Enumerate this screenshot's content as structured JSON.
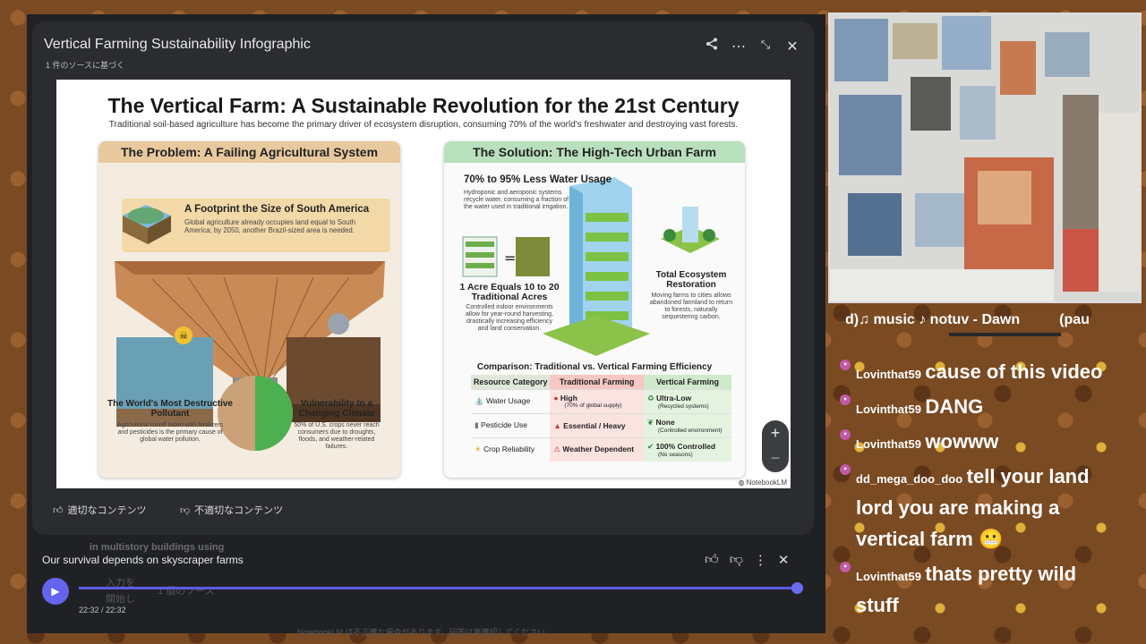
{
  "modal": {
    "title": "Vertical Farming Sustainability Infographic",
    "subtitle": "1 件のソースに基づく",
    "tool_icons": [
      "share-icon",
      "more-icon",
      "collapse-icon",
      "close-icon"
    ]
  },
  "infographic": {
    "title": "The Vertical Farm: A Sustainable Revolution for the 21st Century",
    "subtitle": "Traditional soil-based agriculture has become the primary driver of ecosystem disruption, consuming 70% of the world's freshwater and destroying vast forests.",
    "problem": {
      "heading": "The Problem: A Failing Agricultural System",
      "footprint_title": "A Footprint the Size of South America",
      "footprint_text": "Global agriculture already occupies land equal to South America; by 2050, another Brazil-sized area is needed.",
      "pollutant_title": "The World's Most Destructive Pollutant",
      "pollutant_text": "Agricultural runoff laden with fertilizers and pesticides is the primary cause of global water pollution.",
      "climate_title": "Vulnerability to a Changing Climate",
      "climate_text": "50% of U.S. crops never reach consumers due to droughts, floods, and weather-related failures."
    },
    "solution": {
      "heading": "The Solution: The High-Tech Urban Farm",
      "water_title": "70% to 95% Less Water Usage",
      "water_text": "Hydroponic and aeroponic systems recycle water, consuming a fraction of the water used in traditional irrigation.",
      "acre_title": "1 Acre Equals 10 to 20 Traditional Acres",
      "acre_text": "Controlled indoor environments allow for year-round harvesting, drastically increasing efficiency and land conservation.",
      "eco_title": "Total Ecosystem Restoration",
      "eco_text": "Moving farms to cities allows abandoned farmland to return to forests, naturally sequestering carbon.",
      "compare_title": "Comparison: Traditional vs. Vertical Farming Efficiency",
      "table_headers": [
        "Resource Category",
        "Traditional Farming",
        "Vertical Farming"
      ],
      "table_rows": [
        {
          "category": "Water Usage",
          "trad": "High",
          "trad_note": "(70% of global supply)",
          "vert": "Ultra-Low",
          "vert_note": "(Recycled systems)"
        },
        {
          "category": "Pesticide Use",
          "trad": "Essential / Heavy",
          "trad_note": "",
          "vert": "None",
          "vert_note": "(Controlled environment)"
        },
        {
          "category": "Crop Reliability",
          "trad": "Weather Dependent",
          "trad_note": "",
          "vert": "100% Controlled",
          "vert_note": "(No seasons)"
        }
      ]
    },
    "watermark": "NotebookLM"
  },
  "zoom": {
    "plus": "+",
    "minus": "−"
  },
  "feedback": {
    "good": "適切なコンテンツ",
    "bad": "不適切なコンテンツ"
  },
  "player": {
    "title": "Our survival depends on skyscraper farms",
    "time": "22:32 / 22:32",
    "progress": 1.0
  },
  "background_ghost": {
    "line1": "in multistory buildings using",
    "line2": "入力を",
    "line3": "開始し",
    "line4": "1 個のソース",
    "disclaimer": "NotebookLM は不正確な場合があります。回答は再確認してください。"
  },
  "stream": {
    "now_playing": "d)♫ music ♪ notuv - Dawn",
    "now_playing_tail": "(pau",
    "chat": [
      {
        "user": "Lovinthat59",
        "text": "cause of this video"
      },
      {
        "user": "Lovinthat59",
        "text": "DANG"
      },
      {
        "user": "Lovinthat59",
        "text": "wowww"
      },
      {
        "user": "dd_mega_doo_doo",
        "text": "tell your land lord you are making a vertical farm 😬"
      },
      {
        "user": "Lovinthat59",
        "text": "thats pretty wild stuff"
      }
    ]
  }
}
